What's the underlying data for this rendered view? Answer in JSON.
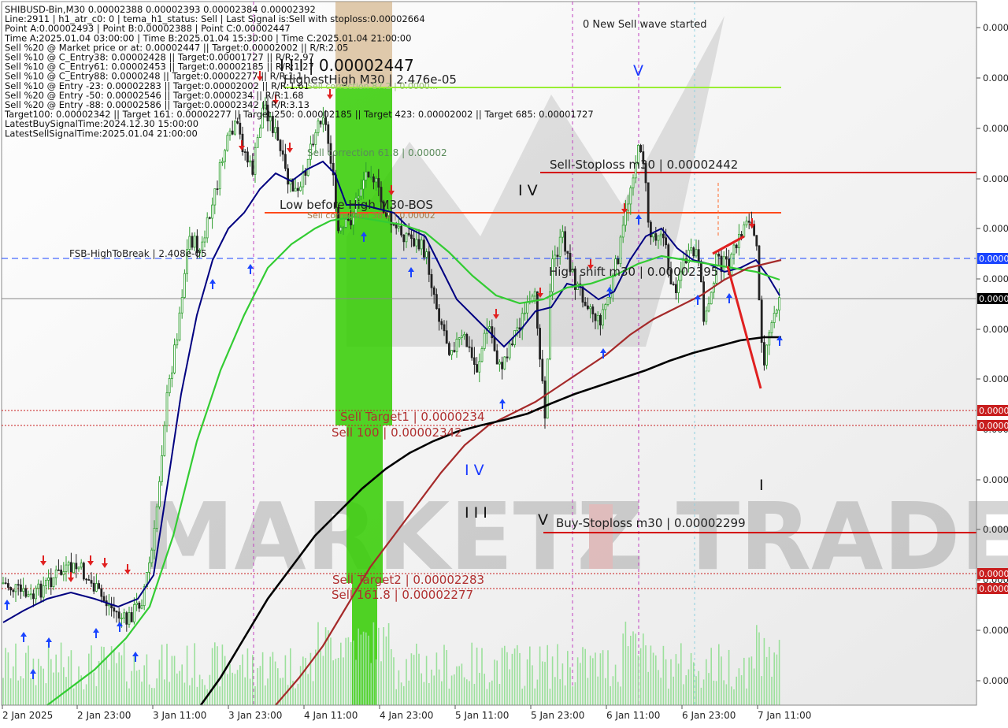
{
  "header": {
    "lines": [
      "SHIBUSD-Bin,M30  0.00002388 0.00002393 0.00002384 0.00002392",
      "Line:2911  |  h1_atr_c0: 0  |  tema_h1_status: Sell  |  Last Signal is:Sell with stoploss:0.00002664",
      "Point A:0.00002493  |  Point B:0.00002388  |  Point C:0.00002447",
      "Time A:2025.01.04 03:00:00  |  Time B:2025.01.04 15:30:00  |  Time C:2025.01.04 21:00:00",
      "Sell %20 @ Market price or at: 0.00002447  ||  Target:0.00002002  ||  R/R:2.05",
      "Sell %10 @ C_Entry38: 0.00002428  ||  Target:0.00001727  ||  R/R:2.97",
      "Sell %10 @ C_Entry61: 0.00002453  ||  Target:0.00002185  ||  R/R:1.27",
      "Sell %10 @ C_Entry88: 0.0000248  ||  Target:0.00002277  ||  R/R:1.1",
      "Sell %10 @ Entry -23: 0.00002283  ||  Target:0.00002002  ||  R/R:1.61",
      "Sell %20 @ Entry -50: 0.00002546  ||  Target:0.0000234  ||  R/R:1.68",
      "Sell %20 @ Entry -88: 0.00002586  ||  Target:0.00002342  ||  R/R:3.13",
      "Target100: 0.00002342  ||  Target 161: 0.00002277  ||  Target 250: 0.00002185  ||  Target 423: 0.00002002  ||  Target 685: 0.00001727",
      "LatestBuySignalTime:2024.12.30 15:00:00",
      "LatestSellSignalTime:2025.01.04 21:00:00"
    ]
  },
  "annotations": {
    "wave_started": "0 New Sell wave started",
    "big_label": "I I I | 0.00002447",
    "highest_high": "HighestHigh   M30 | 2.476e-05",
    "sell_correction_87": "Sell correction 87.2 | 0.0000...",
    "sell_correction_618": "Sell correction 61.8 | 0.00002",
    "sell_correction_382": "Sell correction 38.2 | 0.00002",
    "low_before_high": "Low before High   M30-BOS",
    "fsb_high": "FSB-HighToBreak | 2.408e-05",
    "high_shift": "High shift m30 | 0.00002395",
    "sell_stoploss": "Sell-Stoploss m30 | 0.00002442",
    "buy_stoploss": "Buy-Stoploss m30 | 0.00002299",
    "sell_target1": "Sell Target1 | 0.0000234",
    "sell_100": "Sell 100 | 0.00002342",
    "sell_target2": "Sell Target2 | 0.00002283",
    "sell_1618": "Sell 161.8 | 0.00002277",
    "wave_IV_top": "I V",
    "wave_V_top": "V",
    "wave_IV_low": "I V",
    "wave_III": "I I I",
    "wave_V_low": "V",
    "wave_I": "I",
    "watermark": "MARKETZ TRADE"
  },
  "price_axis": {
    "labels": [
      "0.0000",
      "0.0000",
      "0.0000",
      "0.0000",
      "0.0000",
      "0.0000",
      "0.0000",
      "0.0000",
      "0.0000",
      "0.0000",
      "0.0000",
      "0.0000",
      "0.0000",
      "0.0000"
    ],
    "badges": [
      {
        "text": "0.0000",
        "color": "#1a44ff"
      },
      {
        "text": "0.0000",
        "color": "#000000"
      },
      {
        "text": "0.0000",
        "color": "#c81e1e"
      },
      {
        "text": "0.0000",
        "color": "#c81e1e"
      },
      {
        "text": "0.0000",
        "color": "#c81e1e"
      },
      {
        "text": "0.0000",
        "color": "#c81e1e"
      }
    ]
  },
  "time_axis": {
    "labels": [
      "2 Jan 2025",
      "2 Jan 23:00",
      "3 Jan 11:00",
      "3 Jan 23:00",
      "4 Jan 11:00",
      "4 Jan 23:00",
      "5 Jan 11:00",
      "5 Jan 23:00",
      "6 Jan 11:00",
      "6 Jan 23:00",
      "7 Jan 11:00"
    ]
  },
  "colors": {
    "up_candle": "#2e9e2e",
    "down_candle": "#222222",
    "ema_fast": "#000080",
    "ema_mid": "#33cc33",
    "ema_slow": "#a52a2a",
    "ema_200": "#000000",
    "stoploss_line": "#d40000",
    "fsb_line": "#1a44ff",
    "green_zone": "#33cc00",
    "highest_high_line": "#99ee33"
  },
  "chart_data": {
    "type": "candlestick",
    "symbol": "SHIBUSD-Bin",
    "timeframe": "M30",
    "y_range_approx": [
      2.21e-05,
      2.5e-05
    ],
    "levels": [
      {
        "name": "HighestHigh M30",
        "value": 2.476e-05
      },
      {
        "name": "Sell-Stoploss m30",
        "value": 2.442e-05
      },
      {
        "name": "Low before High M30-BOS",
        "value": 2.41e-05
      },
      {
        "name": "FSB-HighToBreak",
        "value": 2.408e-05
      },
      {
        "name": "High shift m30",
        "value": 2.395e-05
      },
      {
        "name": "Sell Target1",
        "value": 2.34e-05
      },
      {
        "name": "Sell 100",
        "value": 2.342e-05
      },
      {
        "name": "Buy-Stoploss m30",
        "value": 2.299e-05
      },
      {
        "name": "Sell Target2",
        "value": 2.283e-05
      },
      {
        "name": "Sell 161.8",
        "value": 2.277e-05
      }
    ],
    "x_ticks": [
      "2 Jan 2025",
      "2 Jan 23:00",
      "3 Jan 11:00",
      "3 Jan 23:00",
      "4 Jan 11:00",
      "4 Jan 23:00",
      "5 Jan 11:00",
      "5 Jan 23:00",
      "6 Jan 11:00",
      "6 Jan 23:00",
      "7 Jan 11:00"
    ],
    "last_close": 2.392e-05
  }
}
